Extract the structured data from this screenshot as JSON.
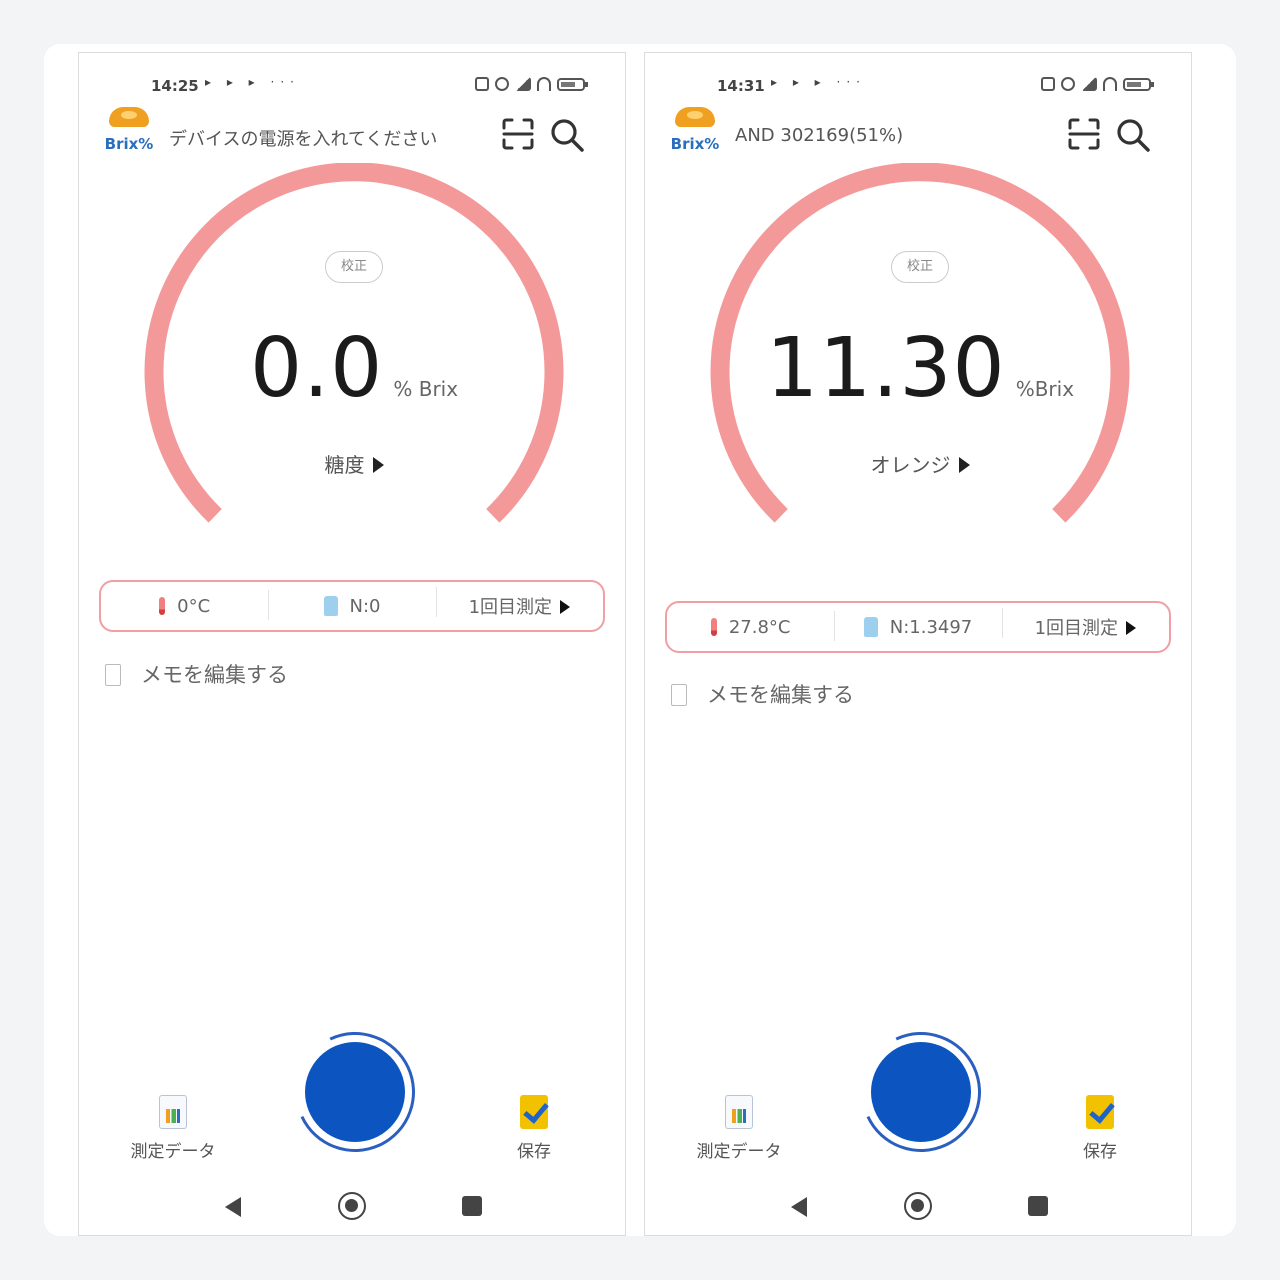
{
  "screens": [
    {
      "status": {
        "time": "14:25",
        "extra": "▸ ▸ ▸ ···"
      },
      "header": {
        "title": "デバイスの電源を入れてください"
      },
      "logo_text": "Brix%",
      "gauge": {
        "calibrate_label": "校正",
        "value": "0.0",
        "unit": "% Brix",
        "category": "糖度"
      },
      "info": {
        "temperature": "0°C",
        "n_value": "N:0",
        "measurement": "1回目測定"
      },
      "memo_label": "メモを編集する",
      "bottom": {
        "data_label": "測定データ",
        "save_label": "保存"
      }
    },
    {
      "status": {
        "time": "14:31",
        "extra": "▸ ▸ ▸ ···"
      },
      "header": {
        "title": "AND 302169(51%)"
      },
      "logo_text": "Brix%",
      "gauge": {
        "calibrate_label": "校正",
        "value": "11.30",
        "unit": "%Brix",
        "category": "オレンジ"
      },
      "info": {
        "temperature": "27.8°C",
        "n_value": "N:1.3497",
        "measurement": "1回目測定"
      },
      "memo_label": "メモを編集する",
      "bottom": {
        "data_label": "測定データ",
        "save_label": "保存"
      }
    }
  ],
  "colors": {
    "gauge_arc": "#f4999a",
    "measure_button": "#0c55c1",
    "infobar_border": "#f0a0a4"
  },
  "icons": [
    "scan-icon",
    "search-icon",
    "thermometer-icon",
    "bottle-icon",
    "memo-icon",
    "chart-data-icon",
    "save-check-icon",
    "back-icon",
    "home-icon",
    "recent-apps-icon"
  ]
}
